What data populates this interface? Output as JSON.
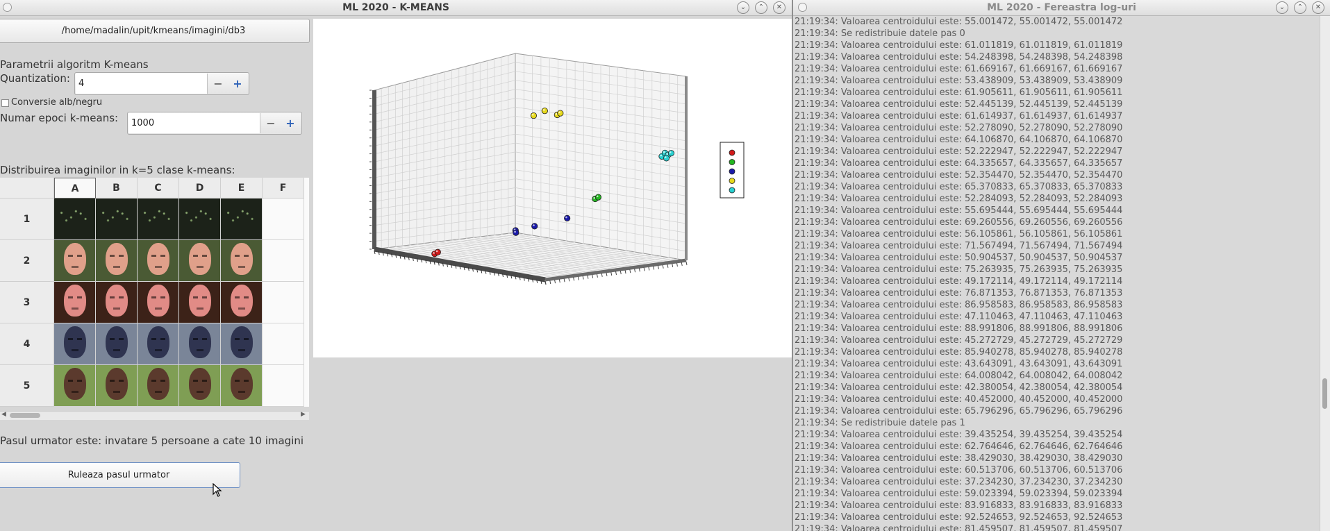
{
  "left_window": {
    "title": "ML 2020 - K-MEANS",
    "path_button": "/home/madalin/upit/kmeans/imagini/db3",
    "params_heading": "Parametrii algoritm K-means",
    "quantization_label": "Quantization:",
    "quantization_value": "4",
    "bw_checkbox_label": "Conversie alb/negru",
    "bw_checked": false,
    "epochs_label": "Numar epoci k-means:",
    "epochs_value": "1000",
    "distribution_label": "Distribuirea imaginilor in k=5 clase k-means:",
    "table": {
      "columns": [
        "A",
        "B",
        "C",
        "D",
        "E",
        "F"
      ],
      "rows": [
        "1",
        "2",
        "3",
        "4",
        "5"
      ],
      "row_themes": [
        {
          "bg": "#1c2219",
          "face": "#1c2219",
          "speck": true
        },
        {
          "bg": "#4a5a34",
          "face": "#e0a08a",
          "speck": false
        },
        {
          "bg": "#3c2218",
          "face": "#e18b86",
          "speck": false
        },
        {
          "bg": "#7a8598",
          "face": "#2f3450",
          "speck": false
        },
        {
          "bg": "#7f9e54",
          "face": "#5b3a2d",
          "speck": false
        }
      ]
    },
    "next_step_text": "Pasul urmator este: invatare 5 persoane a cate 10 imagini",
    "run_button": "Ruleaza pasul urmator"
  },
  "chart_data": {
    "type": "scatter",
    "title": "",
    "xlabel": "",
    "ylabel": "",
    "zlabel": "",
    "grid": true,
    "legend": "right",
    "series": [
      {
        "color": "#d11a1a",
        "points": [
          [
            0.32,
            0.04,
            0.02
          ],
          [
            0.33,
            0.05,
            0.03
          ]
        ]
      },
      {
        "color": "#22b61f",
        "points": [
          [
            0.69,
            0.73,
            0.32
          ],
          [
            0.7,
            0.74,
            0.33
          ]
        ]
      },
      {
        "color": "#1a1aa8",
        "points": [
          [
            0.48,
            0.42,
            0.14
          ],
          [
            0.55,
            0.47,
            0.17
          ],
          [
            0.49,
            0.41,
            0.13
          ],
          [
            0.65,
            0.58,
            0.22
          ]
        ]
      },
      {
        "color": "#e6d81c",
        "points": [
          [
            0.52,
            0.5,
            0.78
          ],
          [
            0.56,
            0.53,
            0.81
          ],
          [
            0.6,
            0.57,
            0.79
          ],
          [
            0.61,
            0.58,
            0.8
          ]
        ]
      },
      {
        "color": "#28d0d0",
        "points": [
          [
            0.94,
            0.9,
            0.58
          ],
          [
            0.95,
            0.91,
            0.6
          ],
          [
            0.96,
            0.92,
            0.59
          ],
          [
            0.97,
            0.93,
            0.6
          ],
          [
            0.95,
            0.92,
            0.57
          ]
        ]
      }
    ],
    "legend_colors": [
      "#d11a1a",
      "#22b61f",
      "#1a1aa8",
      "#e6d81c",
      "#28d0d0"
    ]
  },
  "right_window": {
    "title": "ML 2020 - Fereastra log-uri",
    "log_lines": [
      "21:19:34: Valoarea centroidului este: 55.001472, 55.001472, 55.001472",
      "21:19:34: Se redistribuie datele pas 0",
      "21:19:34: Valoarea centroidului este: 61.011819, 61.011819, 61.011819",
      "21:19:34: Valoarea centroidului este: 54.248398, 54.248398, 54.248398",
      "21:19:34: Valoarea centroidului este: 61.669167, 61.669167, 61.669167",
      "21:19:34: Valoarea centroidului este: 53.438909, 53.438909, 53.438909",
      "21:19:34: Valoarea centroidului este: 61.905611, 61.905611, 61.905611",
      "21:19:34: Valoarea centroidului este: 52.445139, 52.445139, 52.445139",
      "21:19:34: Valoarea centroidului este: 61.614937, 61.614937, 61.614937",
      "21:19:34: Valoarea centroidului este: 52.278090, 52.278090, 52.278090",
      "21:19:34: Valoarea centroidului este: 64.106870, 64.106870, 64.106870",
      "21:19:34: Valoarea centroidului este: 52.222947, 52.222947, 52.222947",
      "21:19:34: Valoarea centroidului este: 64.335657, 64.335657, 64.335657",
      "21:19:34: Valoarea centroidului este: 52.354470, 52.354470, 52.354470",
      "21:19:34: Valoarea centroidului este: 65.370833, 65.370833, 65.370833",
      "21:19:34: Valoarea centroidului este: 52.284093, 52.284093, 52.284093",
      "21:19:34: Valoarea centroidului este: 55.695444, 55.695444, 55.695444",
      "21:19:34: Valoarea centroidului este: 69.260556, 69.260556, 69.260556",
      "21:19:34: Valoarea centroidului este: 56.105861, 56.105861, 56.105861",
      "21:19:34: Valoarea centroidului este: 71.567494, 71.567494, 71.567494",
      "21:19:34: Valoarea centroidului este: 50.904537, 50.904537, 50.904537",
      "21:19:34: Valoarea centroidului este: 75.263935, 75.263935, 75.263935",
      "21:19:34: Valoarea centroidului este: 49.172114, 49.172114, 49.172114",
      "21:19:34: Valoarea centroidului este: 76.871353, 76.871353, 76.871353",
      "21:19:34: Valoarea centroidului este: 86.958583, 86.958583, 86.958583",
      "21:19:34: Valoarea centroidului este: 47.110463, 47.110463, 47.110463",
      "21:19:34: Valoarea centroidului este: 88.991806, 88.991806, 88.991806",
      "21:19:34: Valoarea centroidului este: 45.272729, 45.272729, 45.272729",
      "21:19:34: Valoarea centroidului este: 85.940278, 85.940278, 85.940278",
      "21:19:34: Valoarea centroidului este: 43.643091, 43.643091, 43.643091",
      "21:19:34: Valoarea centroidului este: 64.008042, 64.008042, 64.008042",
      "21:19:34: Valoarea centroidului este: 42.380054, 42.380054, 42.380054",
      "21:19:34: Valoarea centroidului este: 40.452000, 40.452000, 40.452000",
      "21:19:34: Valoarea centroidului este: 65.796296, 65.796296, 65.796296",
      "21:19:34: Se redistribuie datele pas 1",
      "21:19:34: Valoarea centroidului este: 39.435254, 39.435254, 39.435254",
      "21:19:34: Valoarea centroidului este: 62.764646, 62.764646, 62.764646",
      "21:19:34: Valoarea centroidului este: 38.429030, 38.429030, 38.429030",
      "21:19:34: Valoarea centroidului este: 60.513706, 60.513706, 60.513706",
      "21:19:34: Valoarea centroidului este: 37.234230, 37.234230, 37.234230",
      "21:19:34: Valoarea centroidului este: 59.023394, 59.023394, 59.023394",
      "21:19:34: Valoarea centroidului este: 83.916833, 83.916833, 83.916833",
      "21:19:34: Valoarea centroidului este: 92.524653, 92.524653, 92.524653",
      "21:19:34: Valoarea centroidului este: 81.459507, 81.459507, 81.459507"
    ]
  }
}
